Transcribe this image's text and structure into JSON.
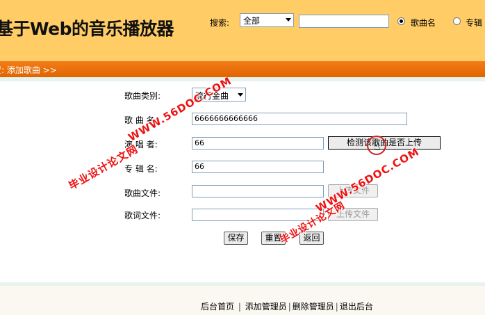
{
  "header": {
    "app_title": "基于Web的音乐播放器",
    "search_label": "搜索:",
    "search_select": "全部",
    "search_value": "",
    "radio_song_label": "歌曲名",
    "radio_singer_label": "专辑"
  },
  "nav": {
    "breadcrumb": "置: 添加歌曲 >>"
  },
  "form": {
    "category_label": "歌曲类别:",
    "category_value": "流行金曲",
    "song_label": "歌 曲 名:",
    "song_value": "6666666666666",
    "singer_label": "演 唱 者:",
    "singer_value": "66",
    "check_button": "检测该歌曲是否上传",
    "album_label": "专 辑 名:",
    "album_value": "66",
    "song_file_label": "歌曲文件:",
    "song_upload": "上传文件",
    "lyric_file_label": "歌词文件:",
    "lyric_upload": "上传文件",
    "save": "保存",
    "reset": "重置",
    "back": "返回"
  },
  "footer": {
    "home": "后台首页",
    "add_admin": "添加管理员",
    "delete_admin": "删除管理员",
    "logout": "退出后台"
  },
  "watermark": {
    "url_text": "WWW.56DOC.COM",
    "cn_text": "毕业设计论文网"
  }
}
